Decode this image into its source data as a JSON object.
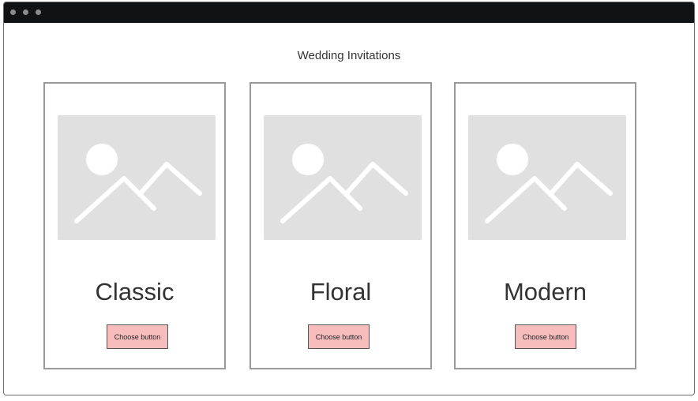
{
  "window": {
    "title_dots": [
      "close-dot",
      "minimize-dot",
      "maximize-dot"
    ]
  },
  "page": {
    "title": "Wedding Invitations"
  },
  "cards": [
    {
      "title": "Classic",
      "button_label": "Choose button",
      "image_icon": "image-placeholder-icon"
    },
    {
      "title": "Floral",
      "button_label": "Choose button",
      "image_icon": "image-placeholder-icon"
    },
    {
      "title": "Modern",
      "button_label": "Choose button",
      "image_icon": "image-placeholder-icon"
    }
  ],
  "colors": {
    "titlebar": "#111214",
    "button_fill": "#f7bdbd",
    "placeholder": "#e0e0e0"
  }
}
